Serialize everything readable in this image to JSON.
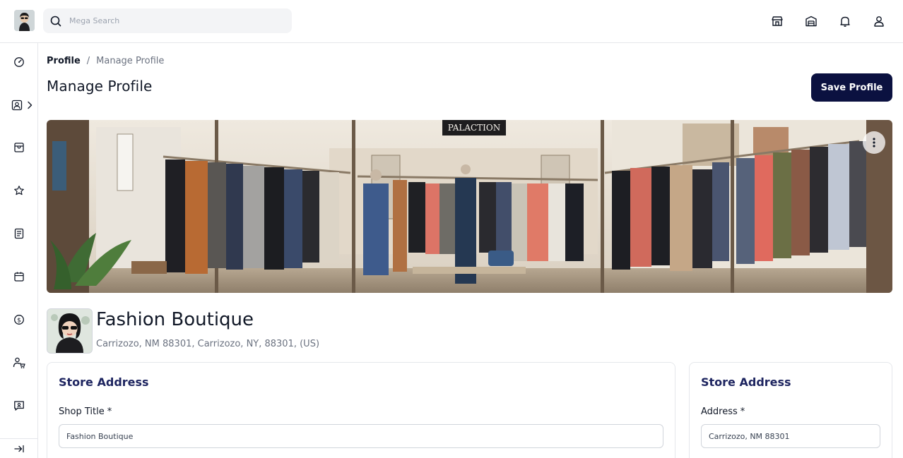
{
  "search": {
    "placeholder": "Mega Search"
  },
  "top_icons": [
    "store-icon",
    "warehouse-icon",
    "bell-icon",
    "user-icon"
  ],
  "sidebar": {
    "items": [
      "dashboard-icon",
      "profile-icon",
      "shop-icon",
      "star-icon",
      "list-icon",
      "calendar-icon",
      "dollar-icon",
      "user-cart-icon",
      "chat-icon"
    ],
    "collapse_icon": "collapse-icon"
  },
  "breadcrumb": {
    "first": "Profile",
    "separator": "/",
    "current": "Manage Profile"
  },
  "page": {
    "title": "Manage Profile",
    "save_label": "Save Profile"
  },
  "banner": {
    "sign_text": "PALACTION"
  },
  "store": {
    "name": "Fashion Boutique",
    "address": "Carrizozo, NM 88301, Carrizozo, NY, 88301, (US)"
  },
  "card_left": {
    "title": "Store Address",
    "field_label": "Shop Title",
    "required_mark": "*",
    "field_value": "Fashion Boutique"
  },
  "card_right": {
    "title": "Store Address",
    "field_label": "Address",
    "required_mark": "*",
    "field_value": "Carrizozo, NM 88301"
  },
  "colors": {
    "primary": "#0b1140",
    "card_title": "#1e2560",
    "muted": "#6b7280"
  }
}
